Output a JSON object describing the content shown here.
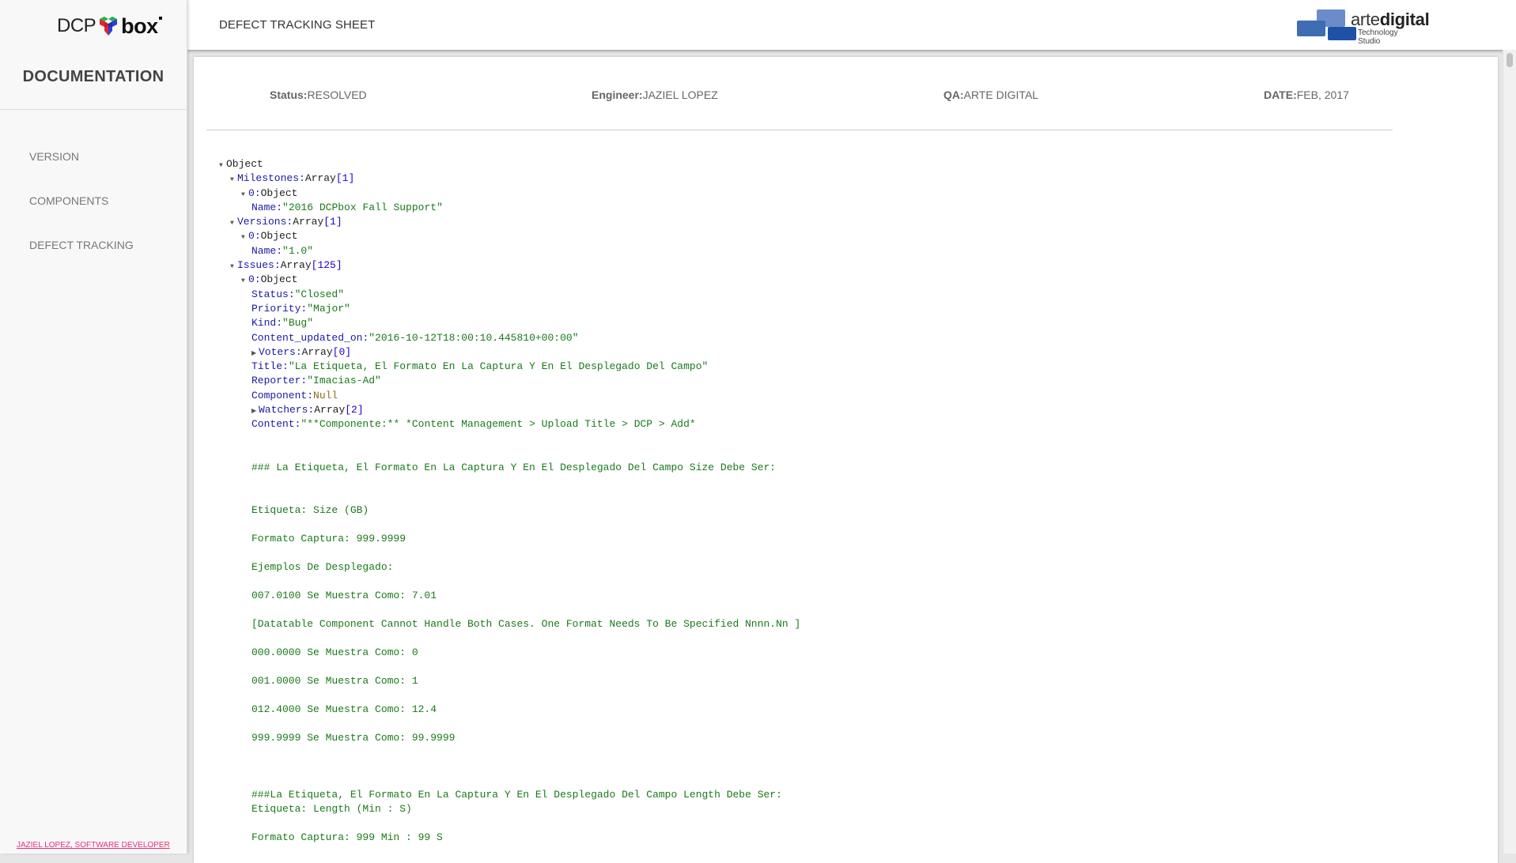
{
  "sidebar": {
    "logo": {
      "left": "DCP",
      "right": "box"
    },
    "title": "DOCUMENTATION",
    "nav": [
      {
        "label": "VERSION"
      },
      {
        "label": "COMPONENTS"
      },
      {
        "label": "DEFECT TRACKING"
      }
    ],
    "footer_link": "JAZIEL LOPEZ, SOFTWARE DEVELOPER"
  },
  "header": {
    "title": "DEFECT TRACKING SHEET",
    "brand": {
      "name_light": "arte",
      "name_bold": "digital",
      "tagline": "Technology Studio"
    }
  },
  "meta": {
    "status": {
      "label": "Status:",
      "value": "RESOLVED"
    },
    "engineer": {
      "label": "Engineer:",
      "value": "JAZIEL LOPEZ"
    },
    "qa": {
      "label": "QA:",
      "value": "ARTE DIGITAL"
    },
    "date": {
      "label": "DATE:",
      "value": "FEB, 2017"
    }
  },
  "tree": {
    "root": "Object",
    "milestones": {
      "key": "Milestones",
      "type": "Array",
      "count": "[1]",
      "item_index": "0",
      "item_type": "Object",
      "name_key": "Name",
      "name_value": "\"2016 DCPbox Fall Support\""
    },
    "versions": {
      "key": "Versions",
      "type": "Array",
      "count": "[1]",
      "item_index": "0",
      "item_type": "Object",
      "name_key": "Name",
      "name_value": "\"1.0\""
    },
    "issues": {
      "key": "Issues",
      "type": "Array",
      "count": "[125]",
      "item_index": "0",
      "item_type": "Object",
      "fields": {
        "status": {
          "key": "Status",
          "value": "\"Closed\""
        },
        "priority": {
          "key": "Priority",
          "value": "\"Major\""
        },
        "kind": {
          "key": "Kind",
          "value": "\"Bug\""
        },
        "content_updated_on": {
          "key": "Content_updated_on",
          "value": "\"2016-10-12T18:00:10.445810+00:00\""
        },
        "voters": {
          "key": "Voters",
          "type": "Array",
          "count": "[0]"
        },
        "title": {
          "key": "Title",
          "value": "\"La Etiqueta, El Formato En La Captura Y En El Desplegado Del Campo\""
        },
        "reporter": {
          "key": "Reporter",
          "value": "\"Imacias-Ad\""
        },
        "component": {
          "key": "Component",
          "value": "Null"
        },
        "watchers": {
          "key": "Watchers",
          "type": "Array",
          "count": "[2]"
        },
        "content": {
          "key": "Content",
          "first_line": "\"**Componente:** *Content Management > Upload Title > DCP > Add*"
        }
      },
      "content_lines": [
        "### La Etiqueta, El Formato En La Captura Y En El Desplegado Del Campo Size Debe Ser:",
        "Etiqueta: Size (GB)",
        "Formato Captura: 999.9999",
        "Ejemplos De Desplegado:",
        "007.0100 Se Muestra Como: 7.01",
        "[Datatable Component Cannot Handle Both Cases. One Format Needs To Be Specified Nnnn.Nn ]",
        "000.0000 Se Muestra Como: 0",
        "001.0000 Se Muestra Como: 1",
        "012.4000 Se Muestra Como: 12.4",
        "999.9999 Se Muestra Como: 99.9999",
        "###La Etiqueta, El Formato En La Captura Y En El Desplegado Del Campo Length Debe Ser:",
        "Etiqueta: Length (Min : S)",
        "Formato Captura: 999 Min : 99 S"
      ]
    }
  }
}
